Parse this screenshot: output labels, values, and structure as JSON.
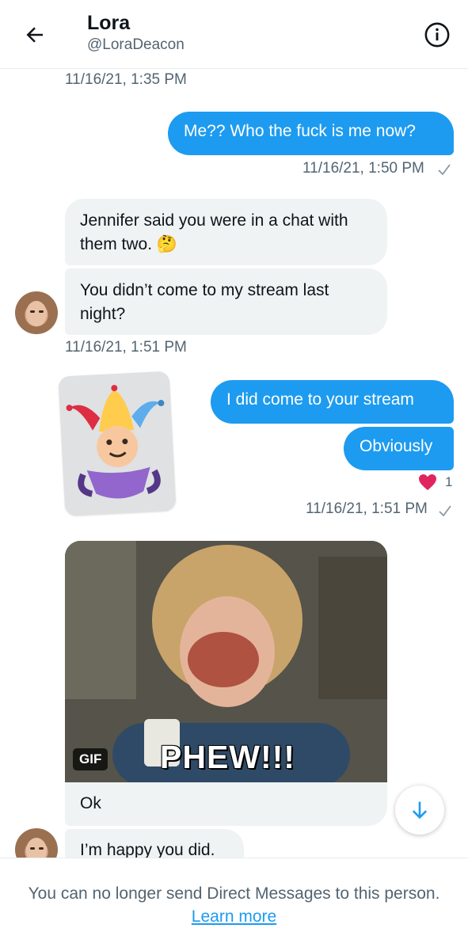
{
  "header": {
    "name": "Lora",
    "handle": "@LoraDeacon"
  },
  "icons": {
    "back": "arrow-left-icon",
    "info": "info-circle-icon",
    "seen": "checkmark-icon",
    "scroll": "arrow-down-icon",
    "reaction": "heart-icon"
  },
  "colors": {
    "accent": "#1d9bf0",
    "incoming_bubble": "#eff3f4",
    "heart": "#f91880"
  },
  "messages": {
    "ts1": "11/16/21, 1:35 PM",
    "out1": "Me?? Who the fuck is me now?",
    "ts2": "11/16/21, 1:50 PM",
    "in1": "Jennifer said you were in a chat with them two. 🤔",
    "in2": "You didn’t come to my stream last night?",
    "ts3": "11/16/21, 1:51 PM",
    "out2": "I did  come to your stream",
    "out3": "Obviously",
    "reaction_count": "1",
    "ts4": "11/16/21, 1:51 PM",
    "gif_badge": "GIF",
    "gif_caption": "PHEW!!!",
    "in3": "Ok",
    "in4": "I’m happy you did."
  },
  "footer": {
    "notice": "You can no longer send Direct Messages to this person.",
    "learn_more": "Learn more"
  }
}
